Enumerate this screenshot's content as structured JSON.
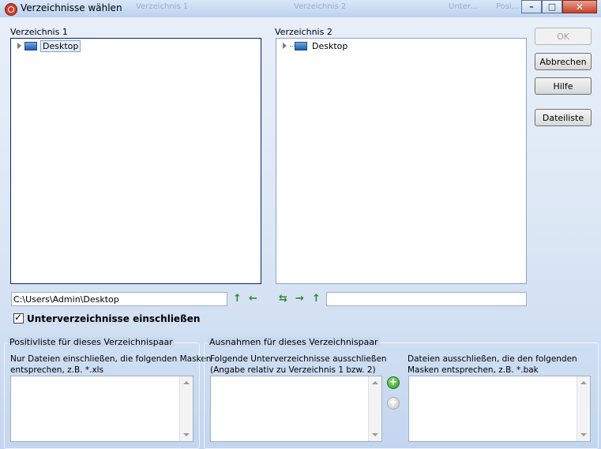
{
  "window": {
    "title": "Verzeichnisse wählen",
    "background_titles": [
      "Verzeichnis 1",
      "Verzeichnis 2",
      "Unter...",
      "Posi..."
    ]
  },
  "dir1": {
    "label": "Verzeichnis 1",
    "tree_root": "Desktop",
    "path_value": "C:\\Users\\Admin\\Desktop"
  },
  "dir2": {
    "label": "Verzeichnis 2",
    "tree_root": "Desktop",
    "path_value": ""
  },
  "buttons": {
    "ok": "OK",
    "cancel": "Abbrechen",
    "help": "Hilfe",
    "filelist": "Dateiliste"
  },
  "include_subdirs": {
    "label": "Unterverzeichnisse einschließen",
    "checked": true
  },
  "positive_group": {
    "legend": "Positivliste für dieses Verzeichnispaar",
    "description_line1": "Nur Dateien einschließen, die folgenden Masken",
    "description_line2": "entsprechen, z.B. *.xls"
  },
  "exceptions_group": {
    "legend": "Ausnahmen für dieses Verzeichnispaar",
    "subdirs_line1": "Folgende Unterverzeichnisse ausschließen",
    "subdirs_line2": "(Angabe relativ zu Verzeichnis 1 bzw. 2)",
    "files_line1": "Dateien ausschließen, die den folgenden",
    "files_line2": "Masken entsprechen, z.B. *.bak"
  },
  "icons": {
    "window_icon": "app-icon",
    "arrow_up": "arrow-up-icon",
    "arrow_left": "arrow-left-icon",
    "arrow_right": "arrow-right-icon",
    "arrow_swap": "swap-arrows-icon",
    "add": "add-icon",
    "remove": "remove-icon"
  },
  "colors": {
    "accent_green": "#2a8a2a",
    "tree_active_border": "#0a246a"
  }
}
